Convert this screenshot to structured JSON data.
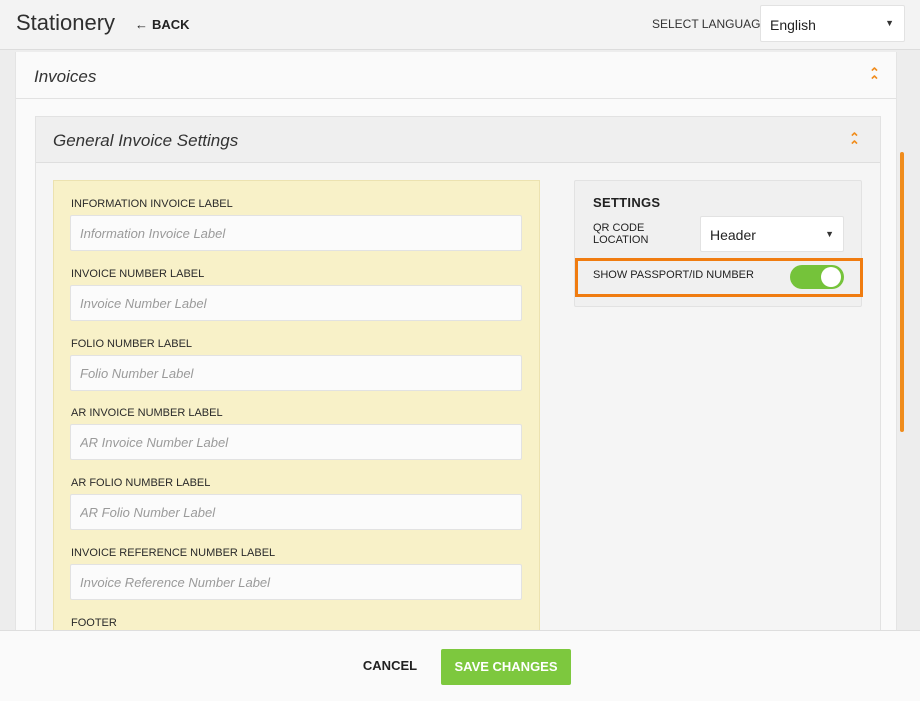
{
  "header": {
    "title": "Stationery",
    "back_label": "BACK",
    "back_icon": "left-arrow-icon",
    "language_label": "SELECT LANGUAGE",
    "language_value": "English"
  },
  "invoices_section": {
    "title": "Invoices",
    "collapse_icon": "double-chevron-up-icon"
  },
  "general_settings": {
    "title": "General Invoice Settings",
    "collapse_icon": "double-chevron-up-icon",
    "fields": [
      {
        "label": "INFORMATION INVOICE LABEL",
        "placeholder": "Information Invoice Label",
        "value": ""
      },
      {
        "label": "INVOICE NUMBER LABEL",
        "placeholder": "Invoice Number Label",
        "value": ""
      },
      {
        "label": "FOLIO NUMBER LABEL",
        "placeholder": "Folio Number Label",
        "value": ""
      },
      {
        "label": "AR INVOICE NUMBER LABEL",
        "placeholder": "AR Invoice Number Label",
        "value": ""
      },
      {
        "label": "AR FOLIO NUMBER LABEL",
        "placeholder": "AR Folio Number Label",
        "value": ""
      },
      {
        "label": "INVOICE REFERENCE NUMBER LABEL",
        "placeholder": "Invoice Reference Number Label",
        "value": ""
      }
    ],
    "footer_label": "FOOTER"
  },
  "settings": {
    "title": "SETTINGS",
    "qr_label_line1": "QR CODE",
    "qr_label_line2": "LOCATION",
    "qr_value": "Header",
    "passport_label": "SHOW PASSPORT/ID NUMBER",
    "passport_enabled": true
  },
  "footer": {
    "cancel_label": "CANCEL",
    "save_label": "SAVE CHANGES"
  },
  "colors": {
    "accent_orange": "#f08c1c",
    "highlight_orange": "#f07c10",
    "toggle_green": "#75c33a",
    "save_green": "#7dc83e",
    "labels_card_bg": "#f8f1c8"
  }
}
